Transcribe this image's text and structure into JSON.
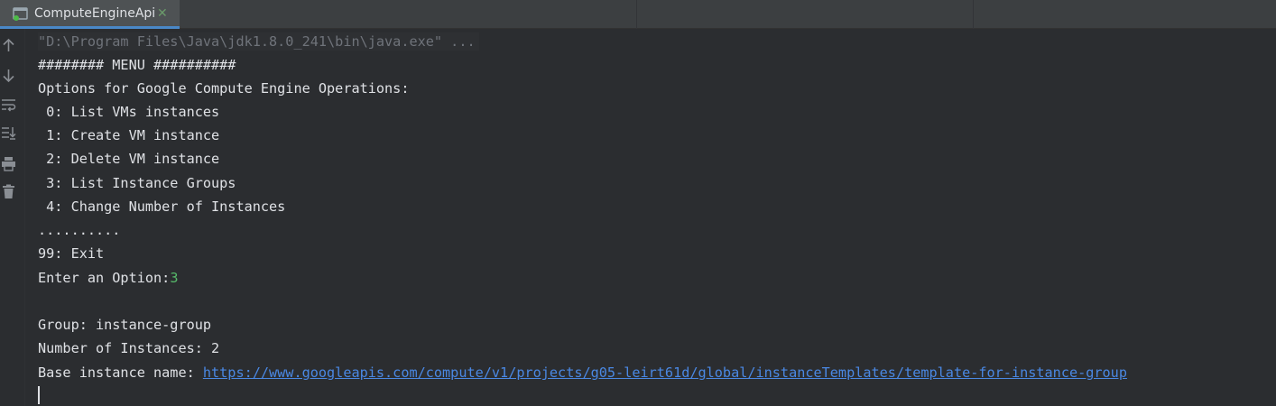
{
  "tab": {
    "title": "ComputeEngineApi",
    "close_glyph": "✕",
    "icon": "console-window-icon",
    "run_indicator_color": "#4cbb47"
  },
  "gutter": {
    "icons": [
      "up-arrow-icon",
      "down-arrow-icon",
      "soft-wrap-icon",
      "scroll-to-end-icon",
      "print-icon",
      "trash-icon"
    ]
  },
  "console": {
    "command": "\"D:\\Program Files\\Java\\jdk1.8.0_241\\bin\\java.exe\" ...",
    "lines": [
      "######## MENU ##########",
      "Options for Google Compute Engine Operations:",
      " 0: List VMs instances",
      " 1: Create VM instance",
      " 2: Delete VM instance",
      " 3: List Instance Groups",
      " 4: Change Number of Instances",
      "..........",
      "99: Exit"
    ],
    "prompt": "Enter an Option:",
    "input_value": "3",
    "group_line": "Group: instance-group",
    "instances_line": "Number of Instances: 2",
    "base_label": "Base instance name: ",
    "base_link": "https://www.googleapis.com/compute/v1/projects/g05-leirt61d/global/instanceTemplates/template-for-instance-group"
  }
}
